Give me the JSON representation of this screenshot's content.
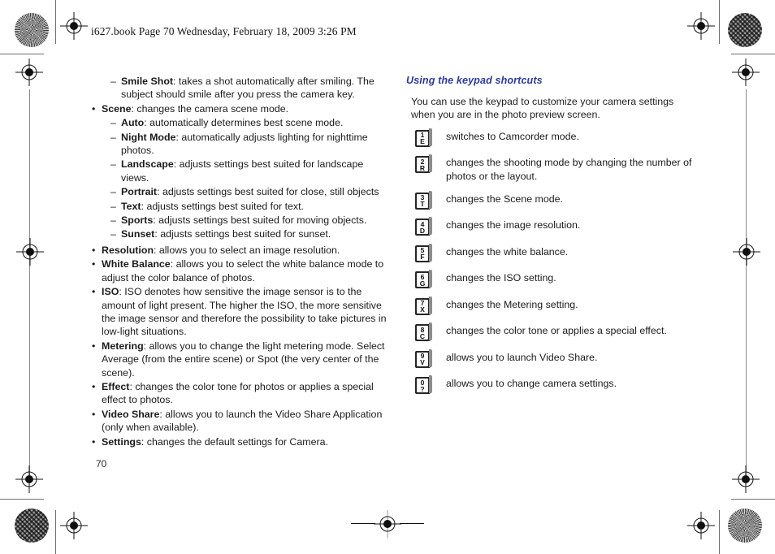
{
  "page": {
    "slugline": "i627.book  Page 70  Wednesday, February 18, 2009  3:26 PM",
    "folio": "70",
    "accent_color": "#2c3c9c",
    "text_color": "#1f1f1f"
  },
  "left_column": {
    "items": [
      {
        "kind": "dash",
        "marker": "–",
        "term": "Smile Shot",
        "text": ": takes a shot automatically after smiling. The subject should smile after you press the camera key."
      },
      {
        "kind": "bullet",
        "marker": "•",
        "term": "Scene",
        "text": ": changes the camera scene mode."
      },
      {
        "kind": "dash",
        "marker": "–",
        "term": "Auto",
        "text": ": automatically determines best scene mode."
      },
      {
        "kind": "dash",
        "marker": "–",
        "term": "Night Mode",
        "text": ": automatically adjusts lighting for nighttime photos."
      },
      {
        "kind": "dash",
        "marker": "–",
        "term": "Landscape",
        "text": ": adjusts settings best suited for landscape views."
      },
      {
        "kind": "dash",
        "marker": "–",
        "term": "Portrait",
        "text": ": adjusts settings best suited for close, still objects"
      },
      {
        "kind": "dash",
        "marker": "–",
        "term": "Text",
        "text": ": adjusts settings best suited for text."
      },
      {
        "kind": "dash",
        "marker": "–",
        "term": "Sports",
        "text": ": adjusts settings best suited for moving objects."
      },
      {
        "kind": "dash",
        "marker": "–",
        "term": "Sunset",
        "text": ": adjusts settings best suited for sunset."
      },
      {
        "kind": "bullet",
        "marker": "•",
        "term": "Resolution",
        "text": ": allows you to select an image resolution."
      },
      {
        "kind": "bullet",
        "marker": "•",
        "term": "White Balance",
        "text": ": allows you to select the white balance mode to adjust the color balance of photos."
      },
      {
        "kind": "bullet",
        "marker": "•",
        "term": "ISO",
        "text": ": ISO denotes how sensitive the image sensor is to the amount of light present. The higher the ISO, the more sensitive the image sensor and therefore the possibility to take pictures in low-light situations."
      },
      {
        "kind": "bullet",
        "marker": "•",
        "term": "Metering",
        "text": ": allows you to change the light metering mode. Select Average (from the entire scene) or Spot (the very center of the scene)."
      },
      {
        "kind": "bullet",
        "marker": "•",
        "term": "Effect",
        "text": ": changes the color tone for photos or applies a special effect to photos."
      },
      {
        "kind": "bullet",
        "marker": "•",
        "term": "Video Share",
        "text": ": allows you to launch the Video Share Application (only when available)."
      },
      {
        "kind": "bullet",
        "marker": "•",
        "term": "Settings",
        "text": ": changes the default settings for Camera."
      }
    ]
  },
  "right_column": {
    "heading": "Using the keypad shortcuts",
    "intro": "You can use the keypad to customize your camera settings when you are in the photo preview screen.",
    "shortcuts": [
      {
        "icon": "key-1-e-icon",
        "num": "1",
        "letter": "E",
        "desc": "switches to Camcorder mode."
      },
      {
        "icon": "key-2-r-icon",
        "num": "2",
        "letter": "R",
        "desc": "changes the shooting mode by changing the number of photos or the layout."
      },
      {
        "icon": "key-3-t-icon",
        "num": "3",
        "letter": "T",
        "desc": "changes the Scene mode."
      },
      {
        "icon": "key-4-d-icon",
        "num": "4",
        "letter": "D",
        "desc": "changes the image resolution."
      },
      {
        "icon": "key-5-f-icon",
        "num": "5",
        "letter": "F",
        "desc": "changes the white balance."
      },
      {
        "icon": "key-6-g-icon",
        "num": "6",
        "letter": "G",
        "desc": "changes the ISO setting."
      },
      {
        "icon": "key-7-x-icon",
        "num": "7",
        "letter": "X",
        "desc": "changes the Metering setting."
      },
      {
        "icon": "key-8-c-icon",
        "num": "8",
        "letter": "C",
        "desc": "changes the color tone or applies a special effect."
      },
      {
        "icon": "key-9-v-icon",
        "num": "9",
        "letter": "V",
        "desc": "allows you to launch Video Share."
      },
      {
        "icon": "key-0-question-icon",
        "num": "0",
        "letter": "?",
        "desc": "allows you to change camera settings."
      }
    ]
  }
}
